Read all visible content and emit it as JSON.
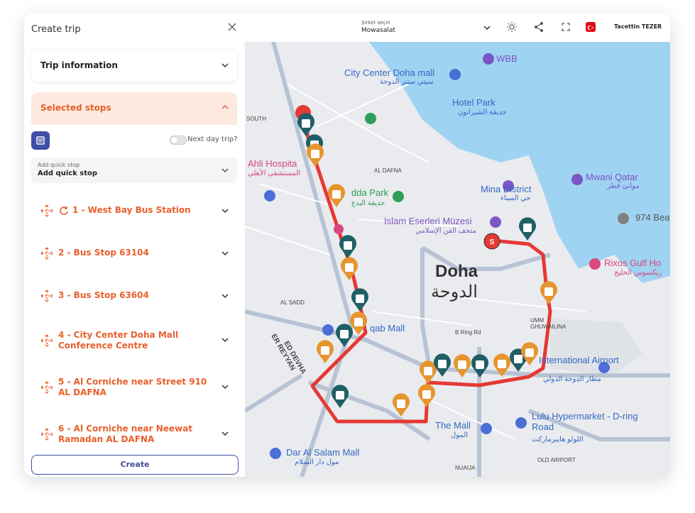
{
  "panel": {
    "title": "Create trip",
    "trip_info_label": "Trip information",
    "selected_stops_label": "Selected stops",
    "next_day_label": "Next day trip?",
    "quick_stop_placeholder": "Add quick stop",
    "quick_stop_value": "Add quick stop",
    "stops": [
      {
        "label": "1 - West Bay Bus Station"
      },
      {
        "label": "2 - Bus Stop 63104"
      },
      {
        "label": "3 - Bus Stop 63604"
      },
      {
        "label": "4 - City Center Doha Mall Conference Centre"
      },
      {
        "label": "5 - Al Corniche near Street 910 AL DAFNA"
      },
      {
        "label": "6 - Al Corniche near Neewat Ramadan AL DAFNA"
      }
    ],
    "create_label": "Create"
  },
  "topbar": {
    "company_placeholder": "Şirket seçin",
    "company_value": "Mowasalat",
    "user_name": "Tacettin TEZER",
    "icons": [
      "sun-icon",
      "share-icon",
      "fullscreen-icon",
      "turkey-flag-icon"
    ]
  },
  "map": {
    "labels": {
      "city_center": "City Center Doha mall",
      "city_center_ar": "سيتي سنتر الدوحة",
      "hotel_park": "Hotel Park",
      "hotel_park_ar": "حديقة الشيراتون",
      "mina": "Mina District",
      "mina_ar": "حي الميناء",
      "mwani": "Mwani Qatar",
      "mwani_ar": "موانئ قطر",
      "islam": "Islam Eserleri Müzesi",
      "islam_ar": "متحف الفن الإسلامي",
      "doha": "Doha",
      "doha_ar": "الدوحة",
      "rixos": "Rixos Gulf Ho",
      "rixos_ar": "ريكسوس الخليج",
      "airport": "International Airport",
      "airport_ar": "مطار الدوحة الدولي",
      "lulu": "Lulu Hypermarket - D-ring Road",
      "lulu_ar": "اللولو هايبرماركت",
      "mall": "The Mall",
      "mall_ar": "المول",
      "dar": "Dar Al Salam Mall",
      "dar_ar": "مول دار السلام",
      "hospital": "Ahli Hospita",
      "hospital_ar": "المستشفى الأهلي",
      "wbb": "WBB",
      "park": "dda Park",
      "park_ar": "حديقة البدع",
      "qab": "qab Mall",
      "road_alsadd": "AL SADD",
      "road_aldafna": "AL DAFNA",
      "road_bring": "B Ring Rd",
      "road_umm": "UMM GHUWAILINA",
      "road_old_airport": "OLD AIRPORT",
      "road_najia": "NUAIJA",
      "road_south": "SOUTH",
      "road_ed_devha": "ED DEVHA",
      "road_er_reyyan": "ER REYYAN",
      "road_974": "974 Bea"
    }
  }
}
